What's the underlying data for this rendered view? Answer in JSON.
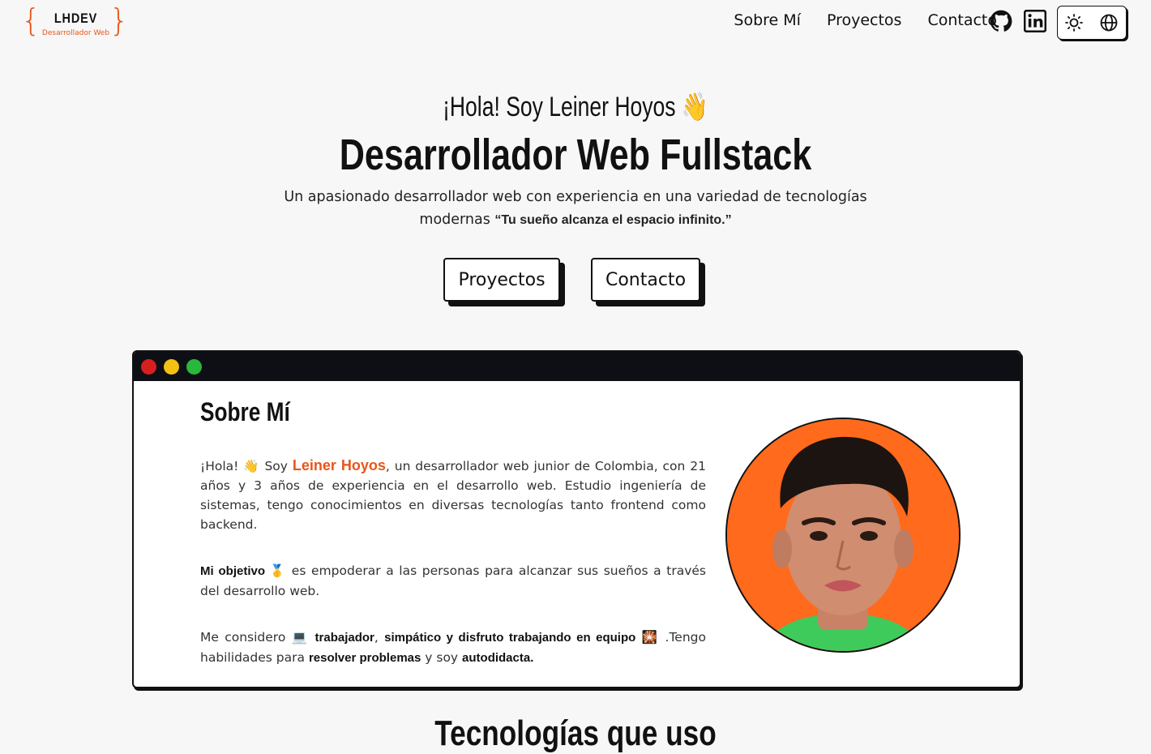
{
  "header": {
    "logo_name": "LHDEV",
    "logo_subtitle": "Desarrollador Web",
    "nav": [
      "Sobre Mí",
      "Proyectos",
      "Contacto"
    ],
    "icons": [
      "github-icon",
      "linkedin-icon",
      "sun-icon",
      "globe-icon"
    ]
  },
  "hero": {
    "greeting": "¡Hola! Soy Leiner Hoyos 👋",
    "title": "Desarrollador Web Fullstack",
    "description": "Un apasionado desarrollador web con experiencia en una variedad de tecnologías modernas ",
    "quote": "“Tu sueño alcanza el espacio infinito.”",
    "buttons": {
      "projects": "Proyectos",
      "contact": "Contacto"
    }
  },
  "about": {
    "heading": "Sobre Mí",
    "p1_start": "¡Hola! 👋  Soy ",
    "p1_name": "Leiner Hoyos",
    "p1_rest": ", un desarrollador web junior de Colombia, con 21 años y 3 años de experiencia en el desarrollo web. Estudio ingeniería de sistemas, tengo conocimientos en diversas tecnologías tanto frontend como backend.",
    "p2_bold": "Mi objetivo 🥇",
    "p2_rest": "  es empoderar a las personas para alcanzar sus sueños a través del desarrollo web.",
    "p3_a": "Me considero 💻  ",
    "p3_b": "trabajador",
    "p3_c": ", ",
    "p3_d": "simpático y disfruto trabajando en equipo",
    "p3_e": " 🎇 .Tengo habilidades para ",
    "p3_f": "resolver problemas",
    "p3_g": " y soy ",
    "p3_h": "autodidacta."
  },
  "next_section": {
    "heading": "Tecnologías que uso"
  },
  "colors": {
    "accent": "#e8561a",
    "dark": "#0d0f14",
    "photo_bg": "#ff6a1c"
  }
}
